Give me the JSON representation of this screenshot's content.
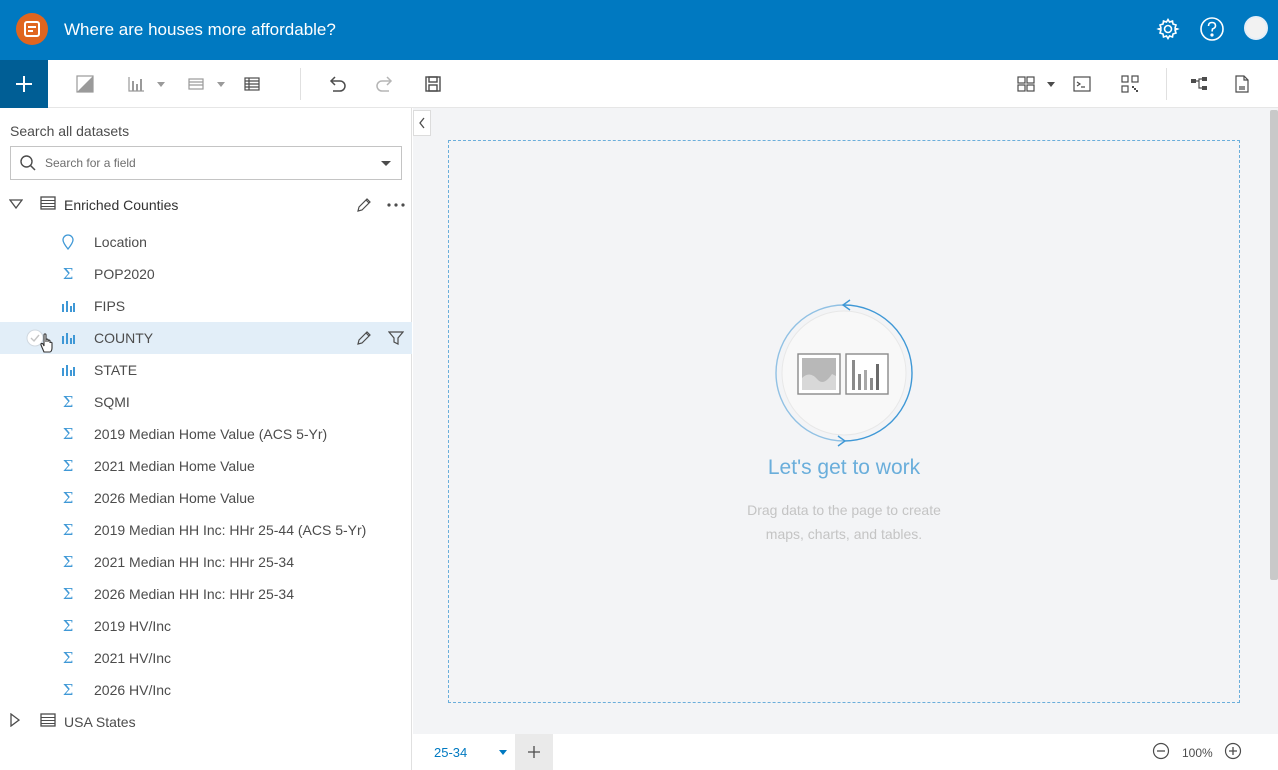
{
  "header": {
    "title": "Where are houses more affordable?",
    "brand_color": "#0079c1",
    "logo_color": "#e0651f",
    "icons": [
      "settings-gear-icon",
      "help-icon",
      "user-avatar"
    ]
  },
  "toolbar": {
    "icons": [
      "add-icon",
      "map-icon",
      "chart-icon",
      "table-icon",
      "summary-table-icon",
      "undo-icon",
      "redo-icon",
      "save-icon",
      "layout-icon",
      "console-icon",
      "qr-icon",
      "model-icon",
      "page-icon"
    ]
  },
  "data_pane": {
    "search_label": "Search all datasets",
    "search_placeholder": "Search for a field",
    "datasets": [
      {
        "name": "Enriched Counties",
        "expanded": true,
        "fields": [
          {
            "label": "Location",
            "type": "location"
          },
          {
            "label": "POP2020",
            "type": "number"
          },
          {
            "label": "FIPS",
            "type": "string"
          },
          {
            "label": "COUNTY",
            "type": "string",
            "selected": true
          },
          {
            "label": "STATE",
            "type": "string"
          },
          {
            "label": "SQMI",
            "type": "number"
          },
          {
            "label": "2019 Median Home Value (ACS 5-Yr)",
            "type": "number"
          },
          {
            "label": "2021 Median Home Value",
            "type": "number"
          },
          {
            "label": "2026 Median Home Value",
            "type": "number"
          },
          {
            "label": "2019 Median HH Inc: HHr 25-44 (ACS 5-Yr)",
            "type": "number"
          },
          {
            "label": "2021 Median HH Inc: HHr 25-34",
            "type": "number"
          },
          {
            "label": "2026 Median HH Inc: HHr 25-34",
            "type": "number"
          },
          {
            "label": "2019 HV/Inc",
            "type": "number"
          },
          {
            "label": "2021 HV/Inc",
            "type": "number"
          },
          {
            "label": "2026 HV/Inc",
            "type": "number"
          }
        ]
      },
      {
        "name": "USA States",
        "expanded": false,
        "fields": []
      }
    ]
  },
  "canvas": {
    "empty_title": "Let's get to work",
    "empty_desc_line1": "Drag data to the page to create",
    "empty_desc_line2": "maps, charts, and tables."
  },
  "footer": {
    "page_tab": "25-34",
    "zoom_level": "100%"
  }
}
